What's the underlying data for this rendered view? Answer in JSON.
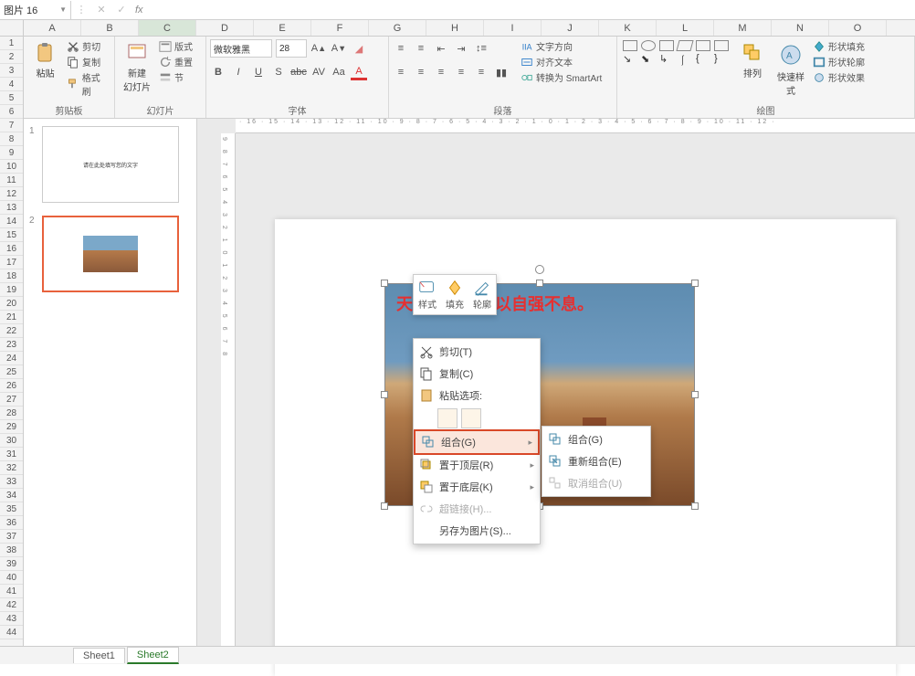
{
  "namebox": "图片 16",
  "fx_label": "fx",
  "columns": [
    "A",
    "B",
    "C",
    "D",
    "E",
    "F",
    "G",
    "H",
    "I",
    "J",
    "K",
    "L",
    "M",
    "N",
    "O"
  ],
  "rows_start": 1,
  "rows_end": 44,
  "ribbon": {
    "clipboard": {
      "label": "剪贴板",
      "paste": "粘贴",
      "cut": "剪切",
      "copy": "复制",
      "painter": "格式刷"
    },
    "slides": {
      "label": "幻灯片",
      "new": "新建\n幻灯片",
      "layout": "版式",
      "reset": "重置",
      "section": "节"
    },
    "font": {
      "label": "字体",
      "name": "微软雅黑",
      "size": "28"
    },
    "para": {
      "label": "段落",
      "textdir": "文字方向",
      "align": "对齐文本",
      "smartart": "转换为 SmartArt"
    },
    "draw": {
      "label": "绘图",
      "arrange": "排列",
      "quick": "快速样式",
      "fill": "形状填充",
      "outline": "形状轮廓",
      "effect": "形状效果"
    }
  },
  "thumbs": {
    "t1_num": "1",
    "t1_text": "请在此处填写您的文字",
    "t2_num": "2"
  },
  "slide_text": "天行健，君子以自强不息。",
  "mini": {
    "style": "样式",
    "fill": "填充",
    "outline": "轮廓"
  },
  "ctx": {
    "cut": "剪切(T)",
    "copy": "复制(C)",
    "paste_header": "粘贴选项:",
    "group": "组合(G)",
    "bringfront": "置于顶层(R)",
    "sendback": "置于底层(K)",
    "hyperlink": "超链接(H)...",
    "saveas": "另存为图片(S)..."
  },
  "submenu": {
    "group": "组合(G)",
    "regroup": "重新组合(E)",
    "ungroup": "取消组合(U)"
  },
  "tabs": {
    "s1": "Sheet1",
    "s2": "Sheet2"
  },
  "ruler_h": "· 16 · 15 · 14 · 13 · 12 · 11 · 10 · 9 · 8 · 7 · 6 · 5 · 4 · 3 · 2 · 1 · 0 · 1 · 2 · 3 · 4 · 5 · 6 · 7 · 8 · 9 · 10 · 11 · 12 ·",
  "ruler_v": "9 8 7 6 5 4 3 2 1 0 1 2 3 4 5 6 7 8"
}
